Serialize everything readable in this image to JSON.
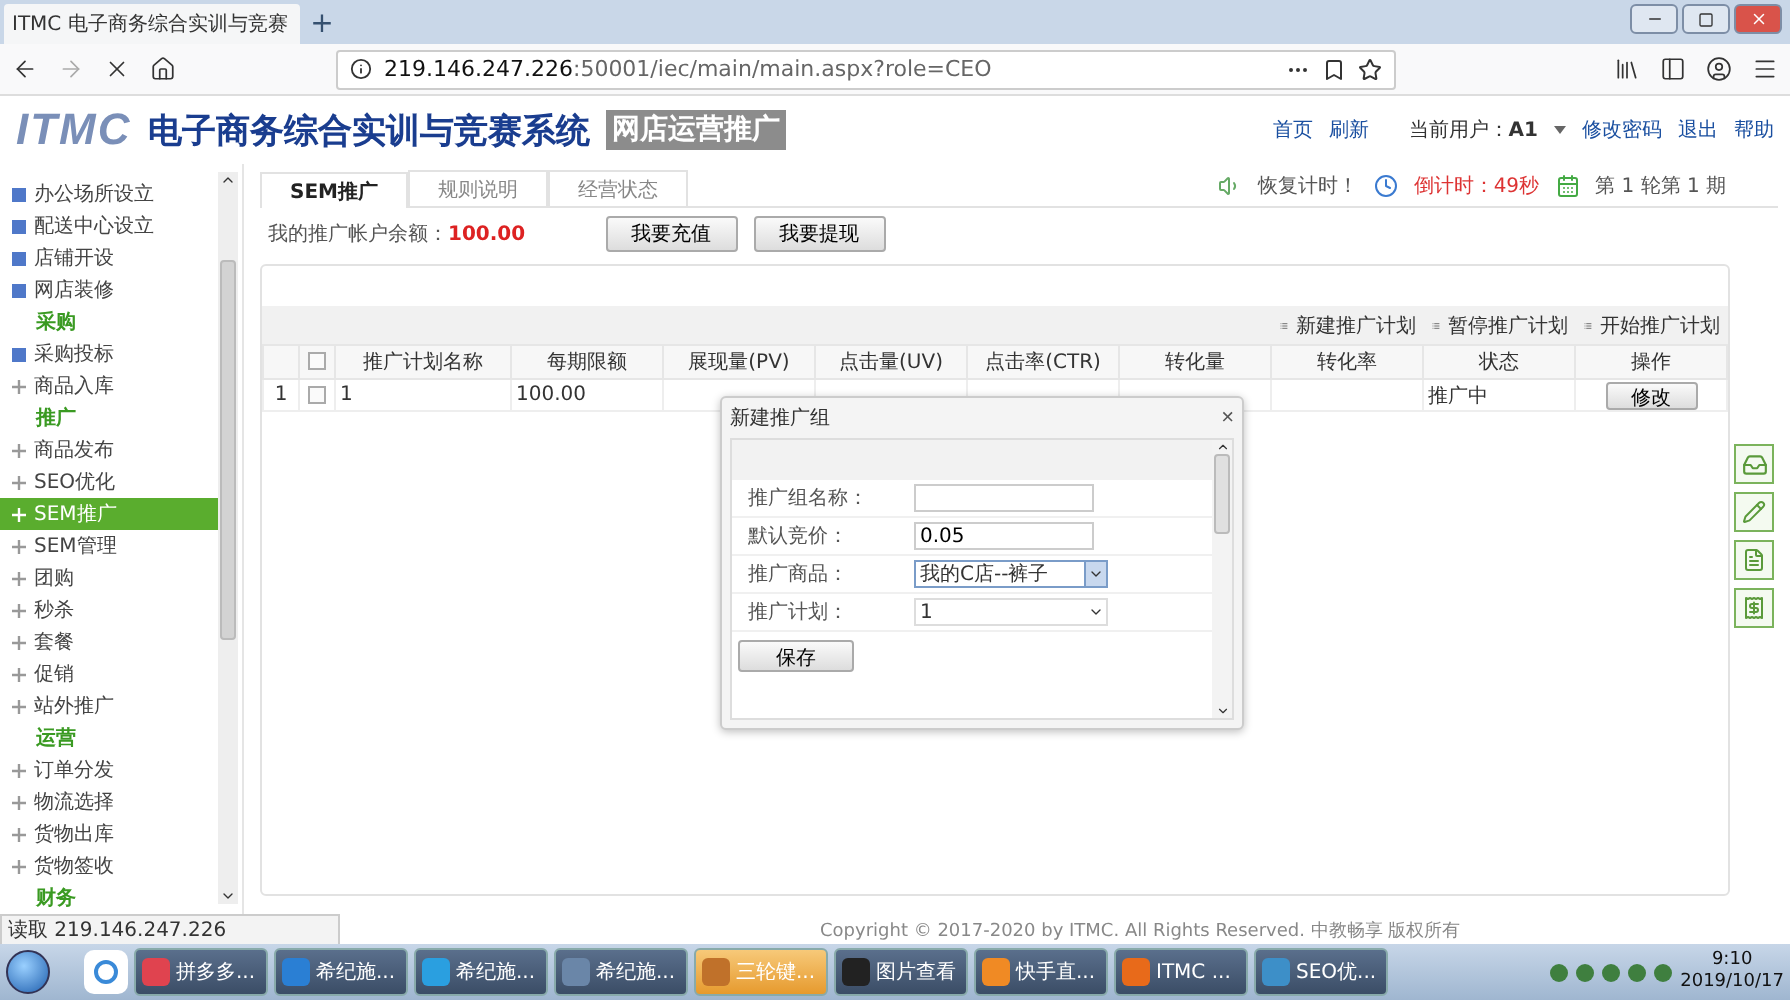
{
  "browser": {
    "tab_title": "ITMC 电子商务综合实训与竞赛",
    "new_tab": "+",
    "url_host": "219.146.247.226",
    "url_rest": ":50001/iec/main/main.aspx?role=CEO"
  },
  "header": {
    "logo": "ITMC",
    "system_name": "电子商务综合实训与竞赛系统",
    "module_badge": "网店运营推广",
    "links": [
      "首页",
      "刷新"
    ],
    "user_label": "当前用户：",
    "user": "A1",
    "user_links": [
      "修改密码",
      "退出",
      "帮助"
    ]
  },
  "sidebar": {
    "items": [
      {
        "kind": "task",
        "label": "办公场所设立",
        "selected": false
      },
      {
        "kind": "task",
        "label": "配送中心设立",
        "selected": false
      },
      {
        "kind": "task",
        "label": "店铺开设",
        "selected": false
      },
      {
        "kind": "task",
        "label": "网店装修",
        "selected": false
      },
      {
        "kind": "heading",
        "label": "采购"
      },
      {
        "kind": "task",
        "label": "采购投标",
        "selected": false
      },
      {
        "kind": "node",
        "label": "商品入库",
        "selected": false
      },
      {
        "kind": "heading",
        "label": "推广"
      },
      {
        "kind": "node",
        "label": "商品发布",
        "selected": false
      },
      {
        "kind": "node",
        "label": "SEO优化",
        "selected": false
      },
      {
        "kind": "node",
        "label": "SEM推广",
        "selected": true
      },
      {
        "kind": "node",
        "label": "SEM管理",
        "selected": false
      },
      {
        "kind": "node",
        "label": "团购",
        "selected": false
      },
      {
        "kind": "node",
        "label": "秒杀",
        "selected": false
      },
      {
        "kind": "node",
        "label": "套餐",
        "selected": false
      },
      {
        "kind": "node",
        "label": "促销",
        "selected": false
      },
      {
        "kind": "node",
        "label": "站外推广",
        "selected": false
      },
      {
        "kind": "heading",
        "label": "运营"
      },
      {
        "kind": "node",
        "label": "订单分发",
        "selected": false
      },
      {
        "kind": "node",
        "label": "物流选择",
        "selected": false
      },
      {
        "kind": "node",
        "label": "货物出库",
        "selected": false
      },
      {
        "kind": "node",
        "label": "货物签收",
        "selected": false
      },
      {
        "kind": "heading",
        "label": "财务"
      }
    ]
  },
  "tabs": [
    {
      "label": "SEM推广",
      "selected": true
    },
    {
      "label": "规则说明",
      "selected": false
    },
    {
      "label": "经营状态",
      "selected": false
    }
  ],
  "status": {
    "resume": "恢复计时！",
    "countdown": "倒计时：49秒",
    "period": "第 1 轮第 1 期"
  },
  "balance": {
    "label": "我的推广帐户余额：",
    "amount": "100.00",
    "buttons": [
      "我要充值",
      "我要提现"
    ]
  },
  "toolbar": [
    "新建推广计划",
    "暂停推广计划",
    "开始推广计划"
  ],
  "table": {
    "columns": [
      "推广计划名称",
      "每期限额",
      "展现量(PV)",
      "点击量(UV)",
      "点击率(CTR)",
      "转化量",
      "转化率",
      "状态",
      "操作"
    ],
    "select_all_checked": false,
    "rows": [
      {
        "index": "1",
        "checked": false,
        "cells": [
          "1",
          "100.00",
          "",
          "",
          "",
          "",
          "",
          "推广中"
        ],
        "action": "修改"
      }
    ]
  },
  "dialog": {
    "title": "新建推广组",
    "close": "×",
    "fields": [
      {
        "kind": "input",
        "label": "推广组名称："
      },
      {
        "kind": "input",
        "label": "默认竞价：",
        "value": "0.05"
      },
      {
        "kind": "select",
        "label": "推广商品：",
        "value": "我的C店--裤子",
        "focused": true
      },
      {
        "kind": "select",
        "label": "推广计划：",
        "value": "1",
        "focused": false
      }
    ],
    "save": "保存"
  },
  "status_bar": {
    "loading": "读取 219.146.247.226",
    "copyright": "Copyright © 2017-2020 by ITMC. All Rights Reserved. 中教畅享 版权所有"
  },
  "taskbar": {
    "items": [
      {
        "label": "拼多多...",
        "color": "#e0434f",
        "highlighted": false
      },
      {
        "label": "希纪施...",
        "color": "#2a7fd4",
        "highlighted": false
      },
      {
        "label": "希纪施...",
        "color": "#2a9fe0",
        "highlighted": false
      },
      {
        "label": "希纪施...",
        "color": "#6a86a8",
        "highlighted": false
      },
      {
        "label": "三轮键...",
        "color": "#c0712a",
        "highlighted": true
      },
      {
        "label": "图片查看",
        "color": "#222222",
        "highlighted": false
      },
      {
        "label": "快手直...",
        "color": "#f08a24",
        "highlighted": false
      },
      {
        "label": "ITMC ...",
        "color": "#e86a1a",
        "highlighted": false
      },
      {
        "label": "SEO优...",
        "color": "#3d8fc8",
        "highlighted": false
      }
    ],
    "time": "9:10",
    "date": "2019/10/17"
  }
}
